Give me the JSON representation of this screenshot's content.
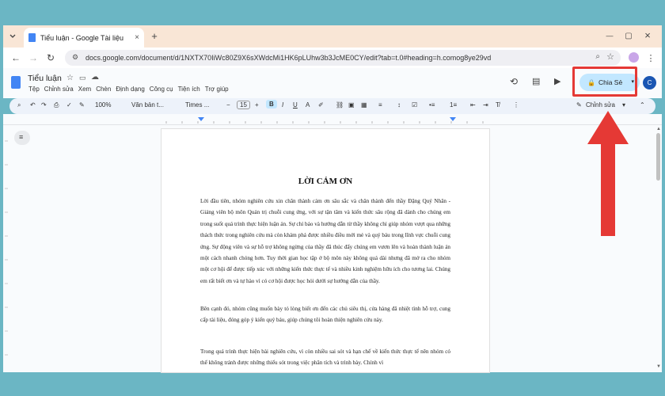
{
  "browser": {
    "tab_title": "Tiểu luận - Google Tài liệu",
    "tab_close": "×",
    "new_tab": "+",
    "url": "docs.google.com/document/d/1NXTX70IiWc80Z9X6sXWdcMi1HK6pLUhw3b3JcME0CY/edit?tab=t.0#heading=h.comog8ye29vd",
    "min": "—",
    "max": "▢",
    "close": "×"
  },
  "docs": {
    "title": "Tiểu luận",
    "menu": [
      "Tệp",
      "Chỉnh sửa",
      "Xem",
      "Chèn",
      "Định dạng",
      "Công cụ",
      "Tiện ích",
      "Trợ giúp"
    ],
    "share_label": "Chia Sẻ",
    "avatar_letter": "C"
  },
  "toolbar": {
    "zoom": "100%",
    "style": "Văn bản t...",
    "font": "Times ...",
    "font_size": "15",
    "mode": "Chỉnh sửa"
  },
  "document": {
    "heading": "LỜI CẢM ƠN",
    "paragraphs": [
      "Lời đầu tiên, nhóm nghiên cứu xin chân thành cảm ơn sâu sắc và chân thành đến thầy Đặng Quý Nhân - Giảng viên bộ môn Quản trị chuỗi cung ứng, với sự tận tâm và kiến thức sâu rộng đã dành cho chúng em trong suốt quá trình thực hiện luận án. Sự chỉ bảo và hướng dẫn từ thầy không chỉ giúp nhóm vượt qua những thách thức trong nghiên cứu mà còn khám phá được nhiều điều mới mẻ và quý báu trong lĩnh vực chuỗi cung ứng. Sự động viên và sự hỗ trợ không ngừng của thầy đã thúc đẩy chúng em vươn lên và hoàn thành luận án một cách nhanh chóng hơn. Tuy thời gian học tập ở bộ môn này không quá dài nhưng đã mở ra cho nhóm một cơ hội để được tiếp xúc với những kiến thức thực tế và nhiều kinh nghiệm hữu ích cho tương lai. Chúng em rất biết ơn và tự hào vì có cơ hội được học hỏi dưới sự hướng dẫn của thầy.",
      "Bên cạnh đó, nhóm cũng muốn bày tỏ lòng biết ơn đến các chủ siêu thị, cửa hàng đã nhiệt tình hỗ trợ, cung cấp tài liệu, đóng góp ý kiến quý báu, giúp chúng tôi hoàn thiện nghiên cứu này.",
      "Trong quá trình thực hiện bài nghiên cứu, vì còn nhiều sai sót và hạn chế về kiến thức thực tế nên nhóm có thể không tránh được những thiếu sót trong việc phân tích và trình bày. Chính vì"
    ]
  },
  "colors": {
    "background": "#6bb6c4",
    "tab_strip": "#f9e6d6",
    "share_button": "#c2e7ff",
    "highlight": "#e53935",
    "docs_blue": "#4285f4"
  }
}
